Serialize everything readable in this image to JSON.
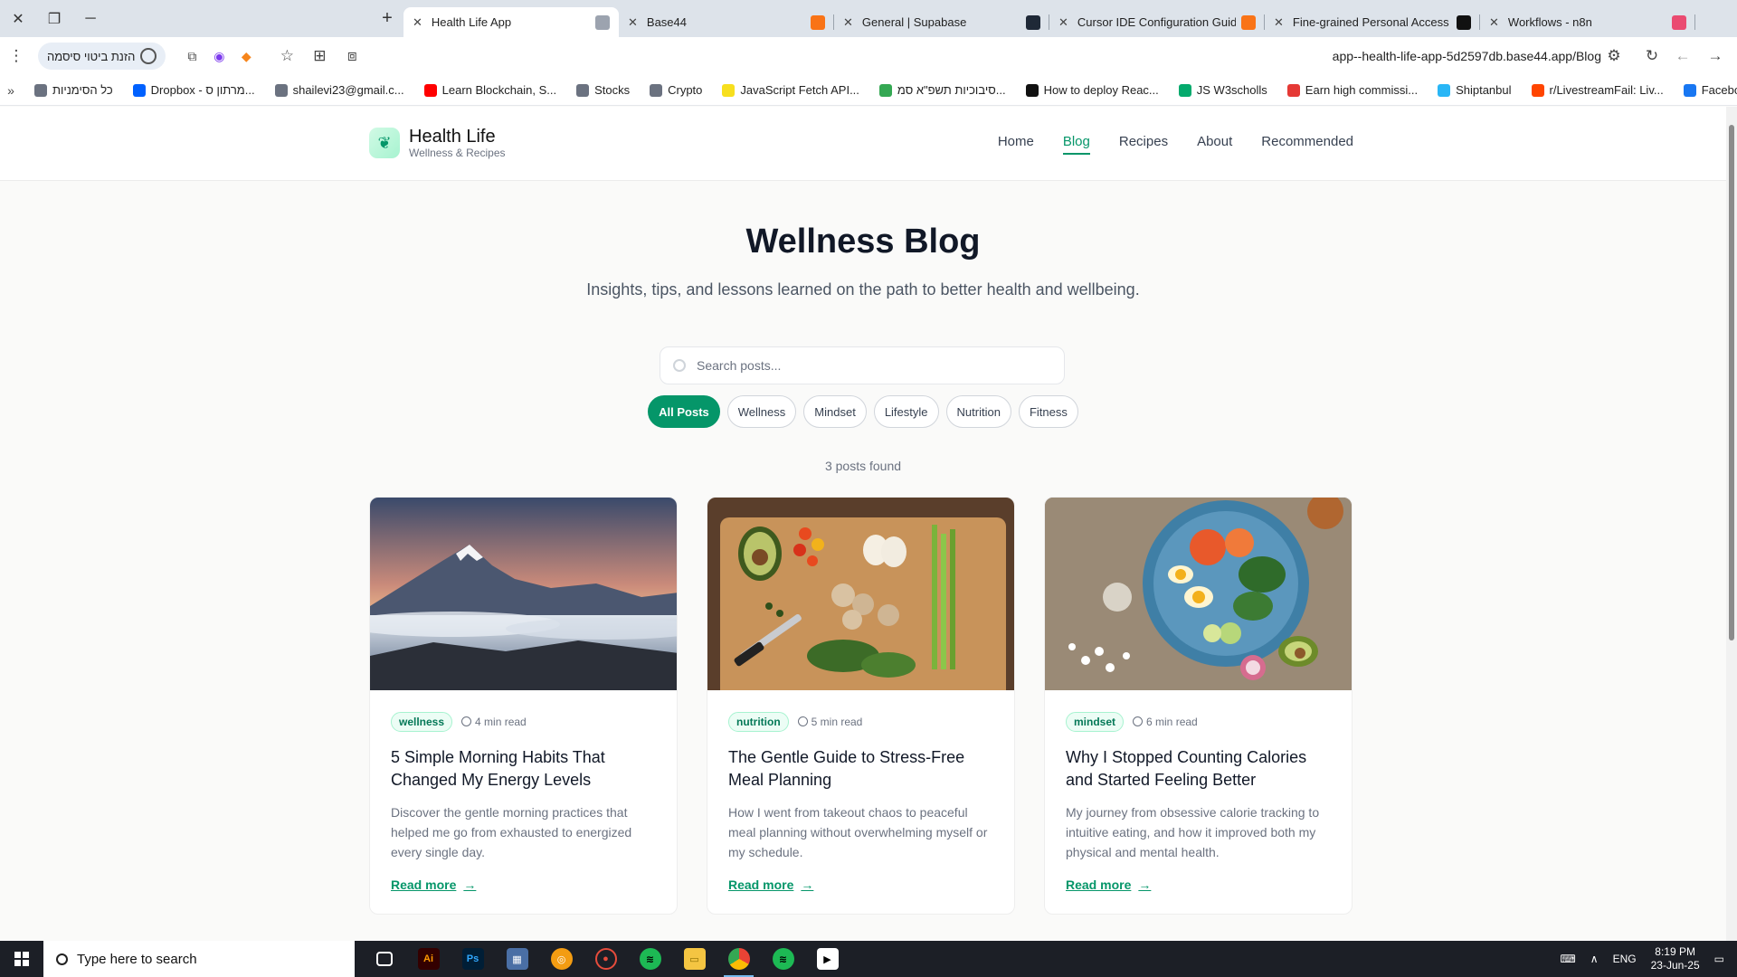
{
  "browser": {
    "tabs": [
      {
        "title": "Health Life App",
        "active": true,
        "favicon_color": "#9ca3af"
      },
      {
        "title": "Base44",
        "active": false,
        "favicon_color": "#f97316"
      },
      {
        "title": "General | Supabase",
        "active": false,
        "favicon_color": "#1f2937"
      },
      {
        "title": "Cursor IDE Configuration Guide",
        "active": false,
        "favicon_color": "#f97316"
      },
      {
        "title": "Fine-grained Personal Access To",
        "active": false,
        "favicon_color": "#111111"
      },
      {
        "title": "Workflows - n8n",
        "active": false,
        "favicon_color": "#ea4b71"
      }
    ],
    "password_chip": "הזנת ביטוי סיסמה",
    "url": "app--health-life-app-5d2597db.base44.app/Blog",
    "bookmarks": [
      {
        "label": "כל הסימניות",
        "color": "#6b7280"
      },
      {
        "label": "Dropbox - מרתון ס...",
        "color": "#0061ff"
      },
      {
        "label": "shailevi23@gmail.c...",
        "color": "#6b7280"
      },
      {
        "label": "Learn Blockchain, S...",
        "color": "#ff0000"
      },
      {
        "label": "Stocks",
        "color": "#6b7280"
      },
      {
        "label": "Crypto",
        "color": "#6b7280"
      },
      {
        "label": "JavaScript Fetch API...",
        "color": "#f7df1e"
      },
      {
        "label": "סיבוכיות תשפ\"א סמ...",
        "color": "#34a853"
      },
      {
        "label": "How to deploy Reac...",
        "color": "#111111"
      },
      {
        "label": "JS W3scholls",
        "color": "#04aa6d"
      },
      {
        "label": "Earn high commissi...",
        "color": "#e53935"
      },
      {
        "label": "Shiptanbul",
        "color": "#29b6f6"
      },
      {
        "label": "r/LivestreamFail: Liv...",
        "color": "#ff4500"
      },
      {
        "label": "Facebook",
        "color": "#1877f2"
      }
    ]
  },
  "site": {
    "brand_name": "Health Life",
    "brand_sub": "Wellness & Recipes",
    "nav": [
      {
        "label": "Home",
        "active": false
      },
      {
        "label": "Blog",
        "active": true
      },
      {
        "label": "Recipes",
        "active": false
      },
      {
        "label": "About",
        "active": false
      },
      {
        "label": "Recommended",
        "active": false
      }
    ],
    "hero_title": "Wellness Blog",
    "hero_sub": "Insights, tips, and lessons learned on the path to better health and wellbeing.",
    "search_placeholder": "Search posts...",
    "filters": [
      {
        "label": "All Posts",
        "active": true
      },
      {
        "label": "Wellness",
        "active": false
      },
      {
        "label": "Mindset",
        "active": false
      },
      {
        "label": "Lifestyle",
        "active": false
      },
      {
        "label": "Nutrition",
        "active": false
      },
      {
        "label": "Fitness",
        "active": false
      }
    ],
    "posts_count": "3 posts found",
    "accent": "#059669",
    "posts": [
      {
        "tag": "wellness",
        "read_time": "4 min read",
        "title": "5 Simple Morning Habits That Changed My Energy Levels",
        "excerpt": "Discover the gentle morning practices that helped me go from exhausted to energized every single day.",
        "cta": "Read more",
        "image": "mountain-sunrise-image"
      },
      {
        "tag": "nutrition",
        "read_time": "5 min read",
        "title": "The Gentle Guide to Stress-Free Meal Planning",
        "excerpt": "How I went from takeout chaos to peaceful meal planning without overwhelming myself or my schedule.",
        "cta": "Read more",
        "image": "cutting-board-vegetables-image"
      },
      {
        "tag": "mindset",
        "read_time": "6 min read",
        "title": "Why I Stopped Counting Calories and Started Feeling Better",
        "excerpt": "My journey from obsessive calorie tracking to intuitive eating, and how it improved both my physical and mental health.",
        "cta": "Read more",
        "image": "salad-bowl-image"
      }
    ]
  },
  "taskbar": {
    "search_placeholder": "Type here to search",
    "language": "ENG",
    "time": "8:19 PM",
    "date": "23-Jun-25"
  }
}
